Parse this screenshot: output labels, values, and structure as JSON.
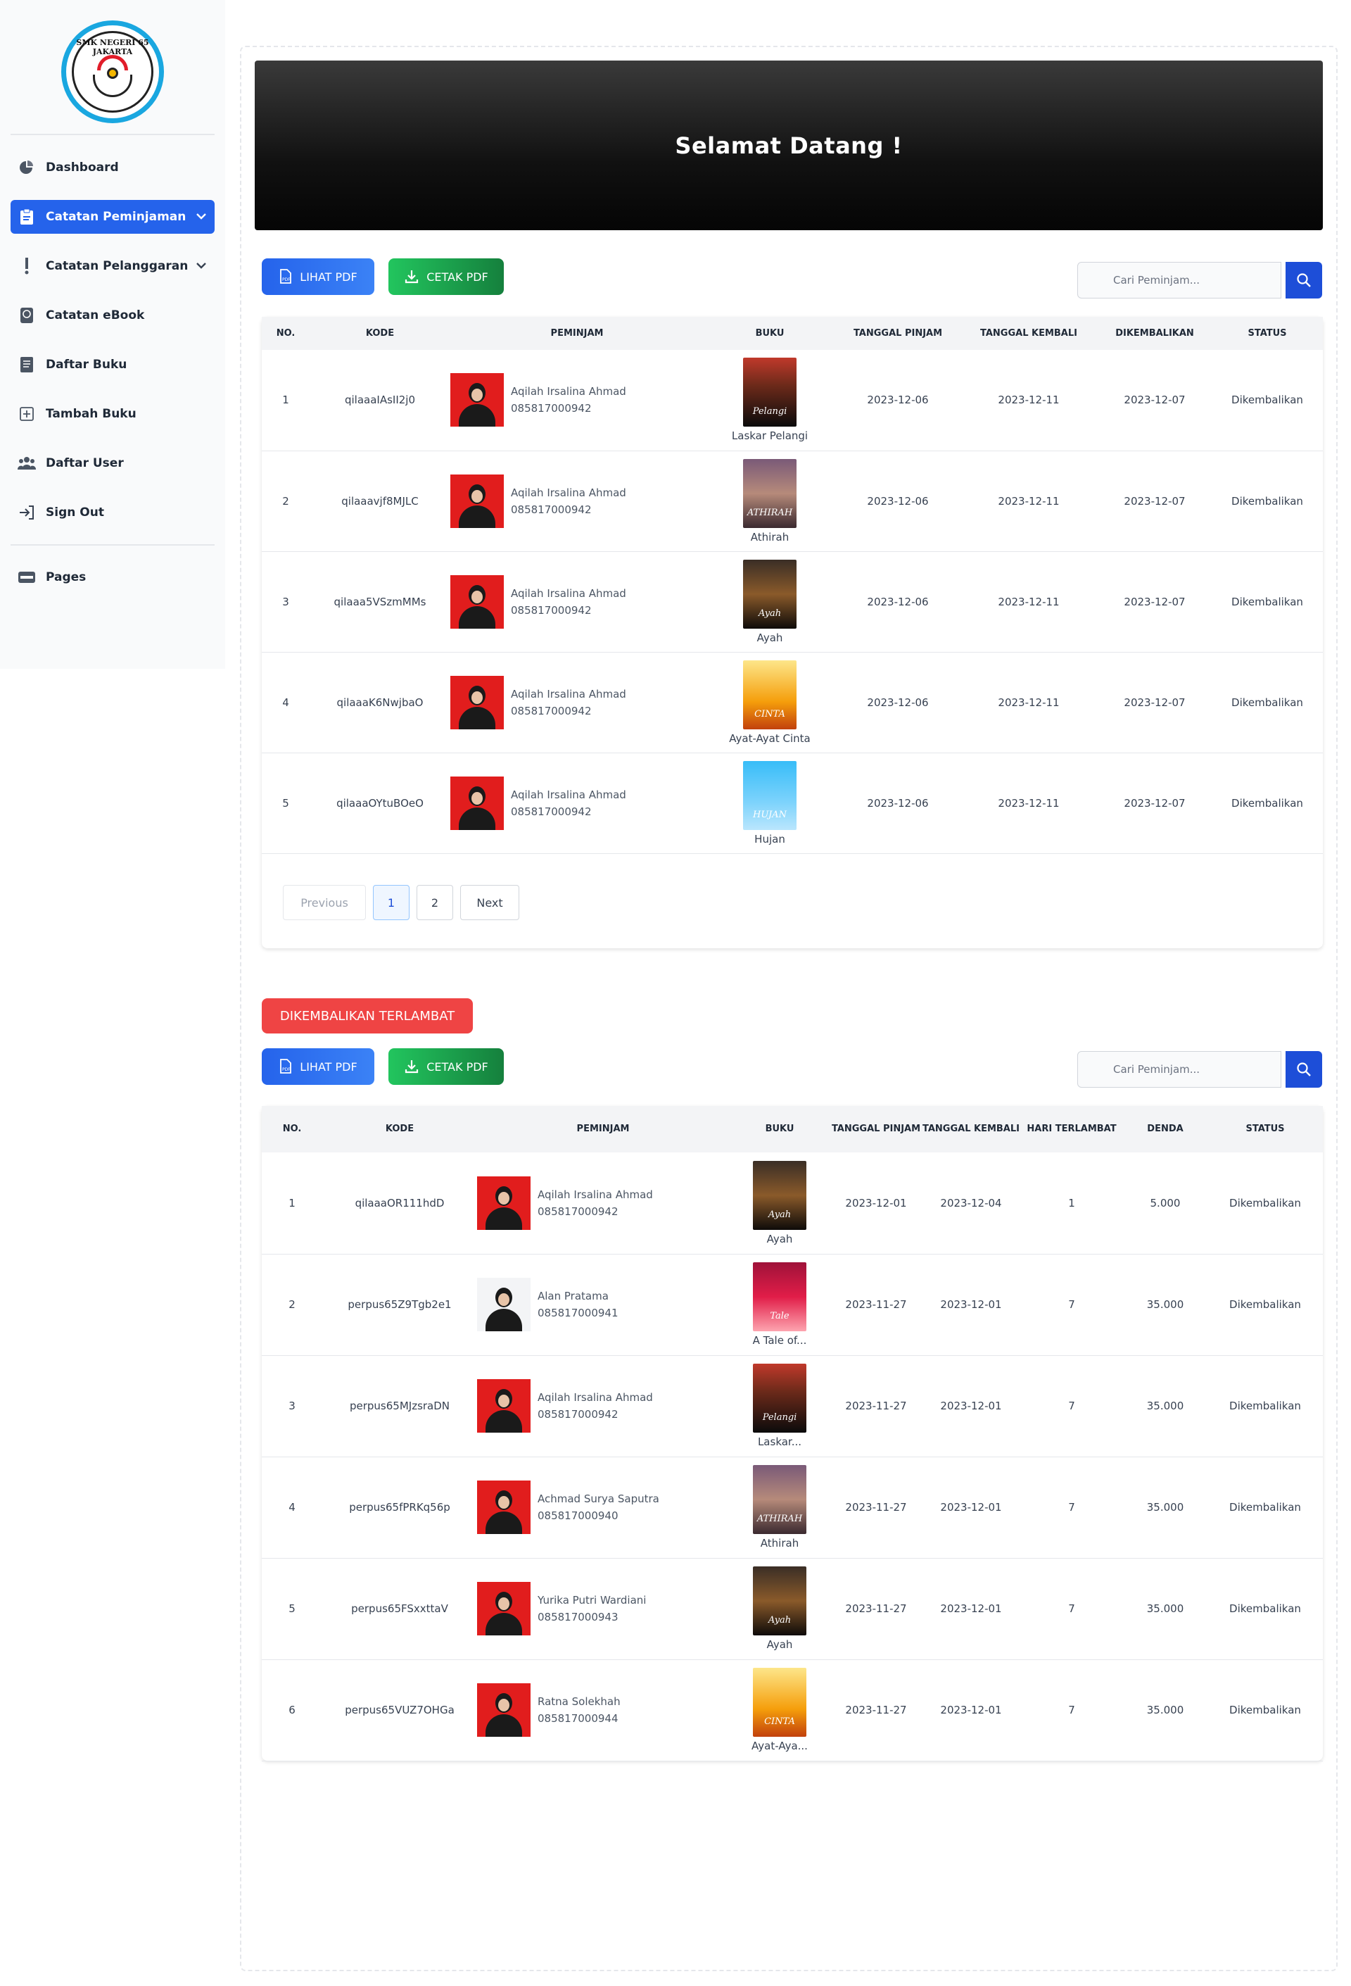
{
  "sidebar": {
    "logo_text": "SMK NEGERI 65 JAKARTA",
    "items": [
      {
        "label": "Dashboard",
        "icon": "pie-chart-icon"
      },
      {
        "label": "Catatan Peminjaman",
        "icon": "clipboard-icon",
        "active": true
      },
      {
        "label": "Catatan Pelanggaran",
        "icon": "exclamation-icon"
      },
      {
        "label": "Catatan eBook",
        "icon": "ebook-icon"
      },
      {
        "label": "Daftar Buku",
        "icon": "book-icon"
      },
      {
        "label": "Tambah Buku",
        "icon": "plus-square-icon"
      },
      {
        "label": "Daftar User",
        "icon": "users-icon"
      },
      {
        "label": "Sign Out",
        "icon": "sign-out-icon"
      },
      {
        "label": "Pages",
        "icon": "pages-icon"
      }
    ]
  },
  "hero": {
    "title": "Selamat Datang !"
  },
  "toolbar": {
    "lihat_pdf": "LIHAT PDF",
    "cetak_pdf": "CETAK PDF",
    "search_placeholder": "Cari Peminjam..."
  },
  "table1": {
    "headers": [
      "NO.",
      "KODE",
      "PEMINJAM",
      "BUKU",
      "TANGGAL PINJAM",
      "TANGGAL KEMBALI",
      "DIKEMBALIKAN",
      "STATUS"
    ],
    "rows": [
      {
        "no": "1",
        "kode": "qilaaaIAsII2j0",
        "nama": "Aqilah Irsalina Ahmad",
        "telp": "085817000942",
        "buku": "Laskar Pelangi",
        "pinjam": "2023-12-06",
        "kembali": "2023-12-11",
        "dikembalikan": "2023-12-07",
        "status": "Dikembalikan"
      },
      {
        "no": "2",
        "kode": "qilaaavjf8MJLC",
        "nama": "Aqilah Irsalina Ahmad",
        "telp": "085817000942",
        "buku": "Athirah",
        "pinjam": "2023-12-06",
        "kembali": "2023-12-11",
        "dikembalikan": "2023-12-07",
        "status": "Dikembalikan"
      },
      {
        "no": "3",
        "kode": "qilaaa5VSzmMMs",
        "nama": "Aqilah Irsalina Ahmad",
        "telp": "085817000942",
        "buku": "Ayah",
        "pinjam": "2023-12-06",
        "kembali": "2023-12-11",
        "dikembalikan": "2023-12-07",
        "status": "Dikembalikan"
      },
      {
        "no": "4",
        "kode": "qilaaaK6NwjbaO",
        "nama": "Aqilah Irsalina Ahmad",
        "telp": "085817000942",
        "buku": "Ayat-Ayat Cinta",
        "pinjam": "2023-12-06",
        "kembali": "2023-12-11",
        "dikembalikan": "2023-12-07",
        "status": "Dikembalikan"
      },
      {
        "no": "5",
        "kode": "qilaaaOYtuBOeO",
        "nama": "Aqilah Irsalina Ahmad",
        "telp": "085817000942",
        "buku": "Hujan",
        "pinjam": "2023-12-06",
        "kembali": "2023-12-11",
        "dikembalikan": "2023-12-07",
        "status": "Dikembalikan"
      }
    ],
    "pagination": {
      "previous": "Previous",
      "pages": [
        "1",
        "2"
      ],
      "current": "1",
      "next": "Next"
    }
  },
  "late_badge": "DIKEMBALIKAN TERLAMBAT",
  "table2": {
    "headers": [
      "NO.",
      "KODE",
      "PEMINJAM",
      "BUKU",
      "TANGGAL PINJAM",
      "TANGGAL KEMBALI",
      "HARI TERLAMBAT",
      "DENDA",
      "STATUS"
    ],
    "rows": [
      {
        "no": "1",
        "kode": "qilaaaOR111hdD",
        "nama": "Aqilah Irsalina Ahmad",
        "telp": "085817000942",
        "buku": "Ayah",
        "pinjam": "2023-12-01",
        "kembali": "2023-12-04",
        "hari": "1",
        "denda": "5.000",
        "status": "Dikembalikan"
      },
      {
        "no": "2",
        "kode": "perpus65Z9Tgb2e1",
        "nama": "Alan Pratama",
        "telp": "085817000941",
        "buku": "A Tale of...",
        "pinjam": "2023-11-27",
        "kembali": "2023-12-01",
        "hari": "7",
        "denda": "35.000",
        "status": "Dikembalikan"
      },
      {
        "no": "3",
        "kode": "perpus65MJzsraDN",
        "nama": "Aqilah Irsalina Ahmad",
        "telp": "085817000942",
        "buku": "Laskar...",
        "pinjam": "2023-11-27",
        "kembali": "2023-12-01",
        "hari": "7",
        "denda": "35.000",
        "status": "Dikembalikan"
      },
      {
        "no": "4",
        "kode": "perpus65fPRKq56p",
        "nama": "Achmad Surya Saputra",
        "telp": "085817000940",
        "buku": "Athirah",
        "pinjam": "2023-11-27",
        "kembali": "2023-12-01",
        "hari": "7",
        "denda": "35.000",
        "status": "Dikembalikan"
      },
      {
        "no": "5",
        "kode": "perpus65FSxxttaV",
        "nama": "Yurika Putri Wardiani",
        "telp": "085817000943",
        "buku": "Ayah",
        "pinjam": "2023-11-27",
        "kembali": "2023-12-01",
        "hari": "7",
        "denda": "35.000",
        "status": "Dikembalikan"
      },
      {
        "no": "6",
        "kode": "perpus65VUZ7OHGa",
        "nama": "Ratna Solekhah",
        "telp": "085817000944",
        "buku": "Ayat-Aya...",
        "pinjam": "2023-11-27",
        "kembali": "2023-12-01",
        "hari": "7",
        "denda": "35.000",
        "status": "Dikembalikan"
      }
    ]
  },
  "covers": {
    "Laskar Pelangi": {
      "bg": "linear-gradient(180deg,#c0392b,#6d2a1a 40%,#0b0b0b)",
      "text": "Pelangi"
    },
    "Athirah": {
      "bg": "linear-gradient(180deg,#7a5a78,#b68a7a 50%,#3b2a30)",
      "text": "ATHIRAH"
    },
    "Ayah": {
      "bg": "linear-gradient(180deg,#3a2e26,#8a5a2a 50%,#0e0b09)",
      "text": "Ayah"
    },
    "Ayat-Ayat Cinta": {
      "bg": "linear-gradient(180deg,#fde68a,#f59e0b 60%,#c2410c)",
      "text": "CINTA"
    },
    "Hujan": {
      "bg": "linear-gradient(180deg,#38bdf8,#7dd3fc 60%,#bae6fd)",
      "text": "HUJAN"
    },
    "A Tale of...": {
      "bg": "linear-gradient(180deg,#9f1239,#e11d48 50%,#fda4af)",
      "text": "Tale"
    },
    "Laskar...": {
      "bg": "linear-gradient(180deg,#c0392b,#6d2a1a 40%,#0b0b0b)",
      "text": "Pelangi"
    },
    "Ayat-Aya...": {
      "bg": "linear-gradient(180deg,#fde68a,#f59e0b 60%,#c2410c)",
      "text": "CINTA"
    }
  }
}
